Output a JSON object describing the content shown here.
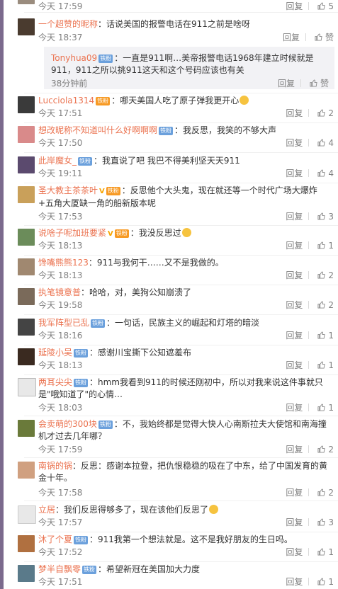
{
  "labels": {
    "reply": "回复"
  },
  "colors": {
    "username": "#eb7350",
    "badge": "#6ba0dc",
    "meta": "#808080",
    "reply_bg": "#f2f2f5"
  },
  "top_partial": {
    "time": "今天 17:59",
    "likes": "5"
  },
  "comments": [
    {
      "user": "一个超赞的昵称",
      "text": "：话说美国的报警电话在911之前是啥呀",
      "time": "今天 18:37",
      "likes": "赞",
      "reply": {
        "user": "Tonyhua09",
        "text": "：一直是911啊…美帝报警电话1968年建立时候就是911，911之所以挑911这天和这个号码应该也有关",
        "time": "38分钟前",
        "likes": "赞"
      }
    },
    {
      "user": "Lucciola1314",
      "text": "：哪天美国人吃了原子弹我更开心",
      "time": "今天 17:51",
      "likes": "2"
    },
    {
      "user": "想改昵称不知道叫什么好啊啊啊",
      "text": "：我反思，我笑的不够大声",
      "time": "今天 17:50",
      "likes": "4"
    },
    {
      "user": "此岸魔女_",
      "text": "：我直说了吧 我巴不得美利坚天天911",
      "time": "今天 19:11",
      "likes": "4"
    },
    {
      "user": "圣大教主茶茶叶",
      "text": "：反思他个大头鬼，现在就还等一个时代广场大爆炸+五角大厦缺一角的船新版本呢",
      "time": "今天 17:53",
      "likes": "3"
    },
    {
      "user": "说啥子呢加班要紧",
      "text": "：我没反思过",
      "time": "今天 18:13",
      "likes": "1"
    },
    {
      "user": "馋嘴熊熊123",
      "text": "：911与我何干……又不是我做的。",
      "time": "今天 18:13",
      "likes": "2"
    },
    {
      "user": "执笔镜意普",
      "text": "：哈哈，对，美狗公知崩溃了",
      "time": "今天 19:58",
      "likes": "2"
    },
    {
      "user": "我军阵型已乱",
      "text": "：一句话，民族主义的崛起和灯塔的暗淡",
      "time": "今天 18:16",
      "likes": "1"
    },
    {
      "user": "延陵小吴",
      "text": "：感谢川宝撕下公知遮羞布",
      "time": "今天 18:13",
      "likes": "1"
    },
    {
      "user": "两耳尖尖",
      "text": "：hmm我看到911的时候还刚初中，所以对我来说这件事就只是\"哦知道了\"的心情…",
      "time": "今天 18:03",
      "likes": "1"
    },
    {
      "user": "会卖萌的300块",
      "text": "：不，我始终都是觉得大快人心南斯拉夫大使馆和南海撞机才过去几年哪？",
      "time": "今天 17:59",
      "likes": "2"
    },
    {
      "user": "南锅的锅",
      "text": "：反思：感谢本拉登，把仇恨稳稳的吸在了中东，给了中国发育的黄金十年。",
      "time": "今天 17:58",
      "likes": "2"
    },
    {
      "user": "立居",
      "text": "：我们反思得够多了，现在该他们反思了",
      "time": "今天 17:57",
      "likes": "3"
    },
    {
      "user": "沐了个夏",
      "text": "：911我第一个想法就是。这不是我好朋友的生日吗。",
      "time": "今天 17:52",
      "likes": "1"
    },
    {
      "user": "梦半自飘零",
      "text": "：希望新冠在美国加大力度",
      "time": "今天 17:51",
      "likes": "1"
    }
  ]
}
